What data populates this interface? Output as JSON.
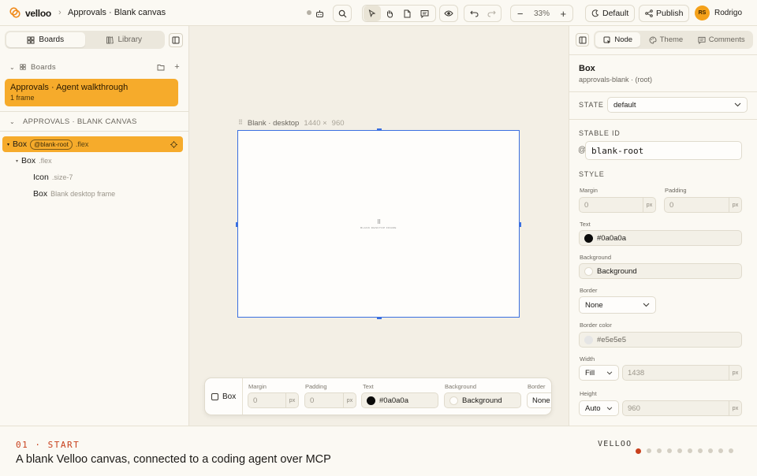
{
  "header": {
    "brand": "velloo",
    "breadcrumb": "Approvals · Blank canvas",
    "zoom": "33%",
    "theme_label": "Default",
    "publish_label": "Publish",
    "user_initials": "RS",
    "user_name": "Rodrigo"
  },
  "sidebar": {
    "tabs": [
      {
        "label": "Boards",
        "icon": "grid-icon",
        "active": true
      },
      {
        "label": "Library",
        "icon": "book-icon",
        "active": false
      }
    ],
    "boards_section": "Boards",
    "board": {
      "title": "Approvals · Agent walkthrough",
      "subtitle": "1 frame"
    },
    "canvas_section": "APPROVALS · BLANK CANVAS",
    "tree": [
      {
        "label": "Box",
        "tag": "@blank-root",
        "meta": ".flex",
        "selected": true
      },
      {
        "label": "Box",
        "meta": ".flex"
      },
      {
        "label": "Icon",
        "meta": ".size-7"
      },
      {
        "label": "Box",
        "meta": "Blank desktop frame"
      }
    ]
  },
  "canvas": {
    "frame_name": "Blank · desktop",
    "frame_w": "1440 ×",
    "frame_h": "960",
    "frame_caption": "BLANK DESKTOP FRAME"
  },
  "dock": {
    "node": "Box",
    "margin_label": "Margin",
    "margin_value": "0",
    "padding_label": "Padding",
    "padding_value": "0",
    "unit": "px",
    "text_label": "Text",
    "text_value": "#0a0a0a",
    "background_label": "Background",
    "background_value": "Background",
    "border_label": "Border",
    "border_value": "None"
  },
  "inspector": {
    "tabs": [
      {
        "label": "Node",
        "icon": "node-icon",
        "active": true
      },
      {
        "label": "Theme",
        "icon": "palette-icon",
        "active": false
      },
      {
        "label": "Comments",
        "icon": "comment-icon",
        "active": false
      }
    ],
    "title": "Box",
    "subtitle": "approvals-blank · (root)",
    "state_label": "STATE",
    "state_value": "default",
    "stable_id_label": "STABLE ID",
    "stable_id_prefix": "@",
    "stable_id": "blank-root",
    "style_label": "STYLE",
    "margin_label": "Margin",
    "margin_value": "0",
    "padding_label": "Padding",
    "padding_value": "0",
    "unit": "px",
    "text_label": "Text",
    "text_value": "#0a0a0a",
    "background_label": "Background",
    "background_value": "Background",
    "border_label": "Border",
    "border_value": "None",
    "border_color_label": "Border color",
    "border_color_value": "#e5e5e5",
    "width_label": "Width",
    "width_mode": "Fill",
    "width_value": "1438",
    "height_label": "Height",
    "height_mode": "Auto",
    "height_value": "960"
  },
  "footer": {
    "step": "01 · START",
    "headline": "A blank Velloo canvas, connected to a coding agent over MCP",
    "brand": "VELLOO",
    "total_steps": 10,
    "current_step": 1
  },
  "colors": {
    "accent": "#f6ab2b",
    "selection": "#3a6fe0",
    "step": "#c8401c",
    "text_swatch": "#0a0a0a",
    "border_swatch": "#e5e5e5"
  }
}
